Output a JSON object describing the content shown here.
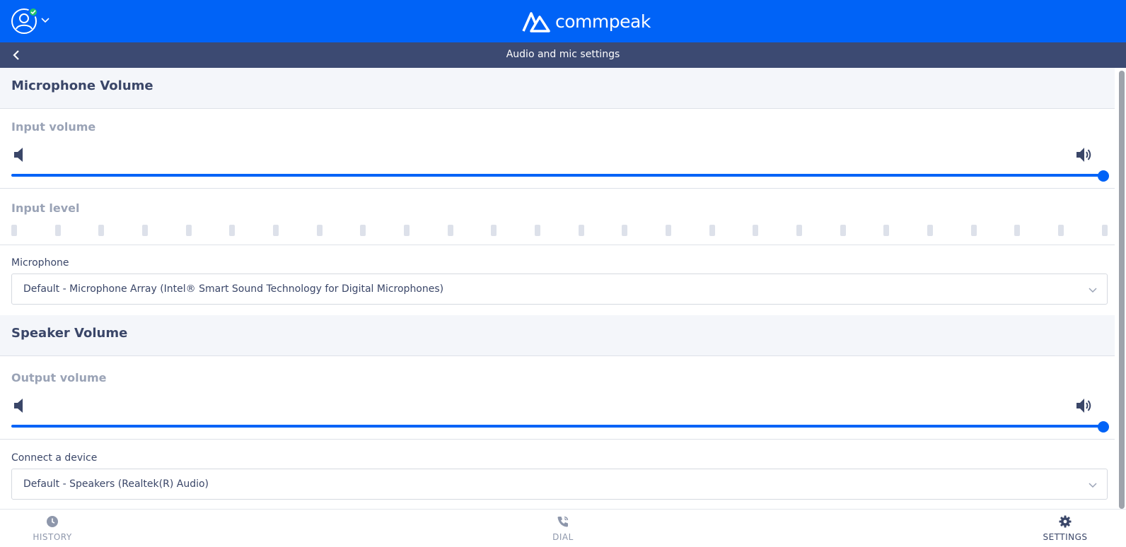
{
  "header": {
    "brand": "commpeak",
    "brand_color": "#0063f7",
    "status_color": "#23c46b"
  },
  "subheader": {
    "title": "Audio and mic settings",
    "back_icon": "chevron-left-icon"
  },
  "microphone": {
    "section_title": "Microphone Volume",
    "input_volume_label": "Input volume",
    "input_volume_value": 100,
    "input_level_label": "Input level",
    "input_level_bars": 26,
    "input_level_active": 0,
    "device_label": "Microphone",
    "device_value": "Default - Microphone Array (Intel® Smart Sound Technology for Digital Microphones)"
  },
  "speaker": {
    "section_title": "Speaker Volume",
    "output_volume_label": "Output volume",
    "output_volume_value": 100,
    "device_label": "Connect a device",
    "device_value": "Default - Speakers (Realtek(R) Audio)"
  },
  "nav": {
    "history": "HISTORY",
    "dial": "DIAL",
    "settings": "SETTINGS",
    "active": "settings"
  }
}
